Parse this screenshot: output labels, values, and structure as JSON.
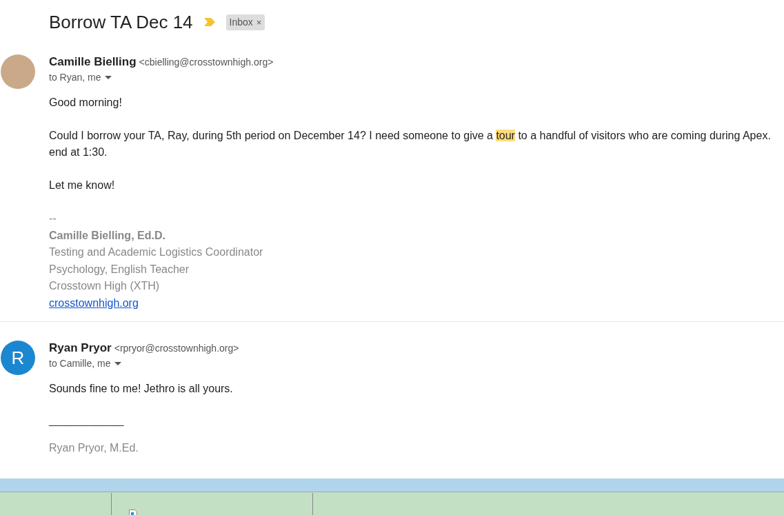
{
  "subject": "Borrow TA Dec 14",
  "important": true,
  "labels": [
    {
      "text": "Inbox",
      "remove": "×"
    }
  ],
  "messages": [
    {
      "avatar": {
        "kind": "photo"
      },
      "sender": "Camille Bielling",
      "email": "<cbielling@crosstownhigh.org>",
      "recipients": "to Ryan, me",
      "body": [
        {
          "kind": "text",
          "lines": [
            [
              {
                "text": "Good morning!",
                "highlighted": false
              }
            ]
          ]
        },
        {
          "kind": "text",
          "lines": [
            [
              {
                "text": "Could I borrow your TA, Ray, during 5th period on December 14?  I need someone to give a ",
                "highlighted": false
              },
              {
                "text": "tour",
                "highlighted": true
              },
              {
                "text": " to a handful of visitors who are coming during Apex.",
                "highlighted": false
              }
            ],
            [
              {
                "text": "end at 1:30.",
                "highlighted": false
              }
            ]
          ]
        },
        {
          "kind": "text",
          "lines": [
            [
              {
                "text": "Let me know!",
                "highlighted": false
              }
            ]
          ]
        }
      ],
      "signature": [
        {
          "kind": "plain",
          "text": "--"
        },
        {
          "kind": "bold",
          "text": "Camille Bielling, Ed.D."
        },
        {
          "kind": "plain",
          "text": "Testing and Academic Logistics Coordinator"
        },
        {
          "kind": "plain",
          "text": "Psychology, English Teacher"
        },
        {
          "kind": "plain",
          "text": "Crosstown High (XTH)"
        },
        {
          "kind": "link",
          "text": "crosstownhigh.org"
        }
      ]
    },
    {
      "avatar": {
        "kind": "initial",
        "letter": "R",
        "color": "#1a87d0"
      },
      "sender": "Ryan Pryor",
      "email": "<rpryor@crosstownhigh.org>",
      "recipients": "to Camille, me",
      "body": [
        {
          "kind": "text",
          "lines": [
            [
              {
                "text": "Sounds fine to me! Jethro is all yours.",
                "highlighted": false
              }
            ]
          ]
        },
        {
          "kind": "rule",
          "text": "_____________"
        }
      ],
      "signature": [
        {
          "kind": "plain",
          "text": "Ryan Pryor, M.Ed."
        }
      ]
    }
  ]
}
